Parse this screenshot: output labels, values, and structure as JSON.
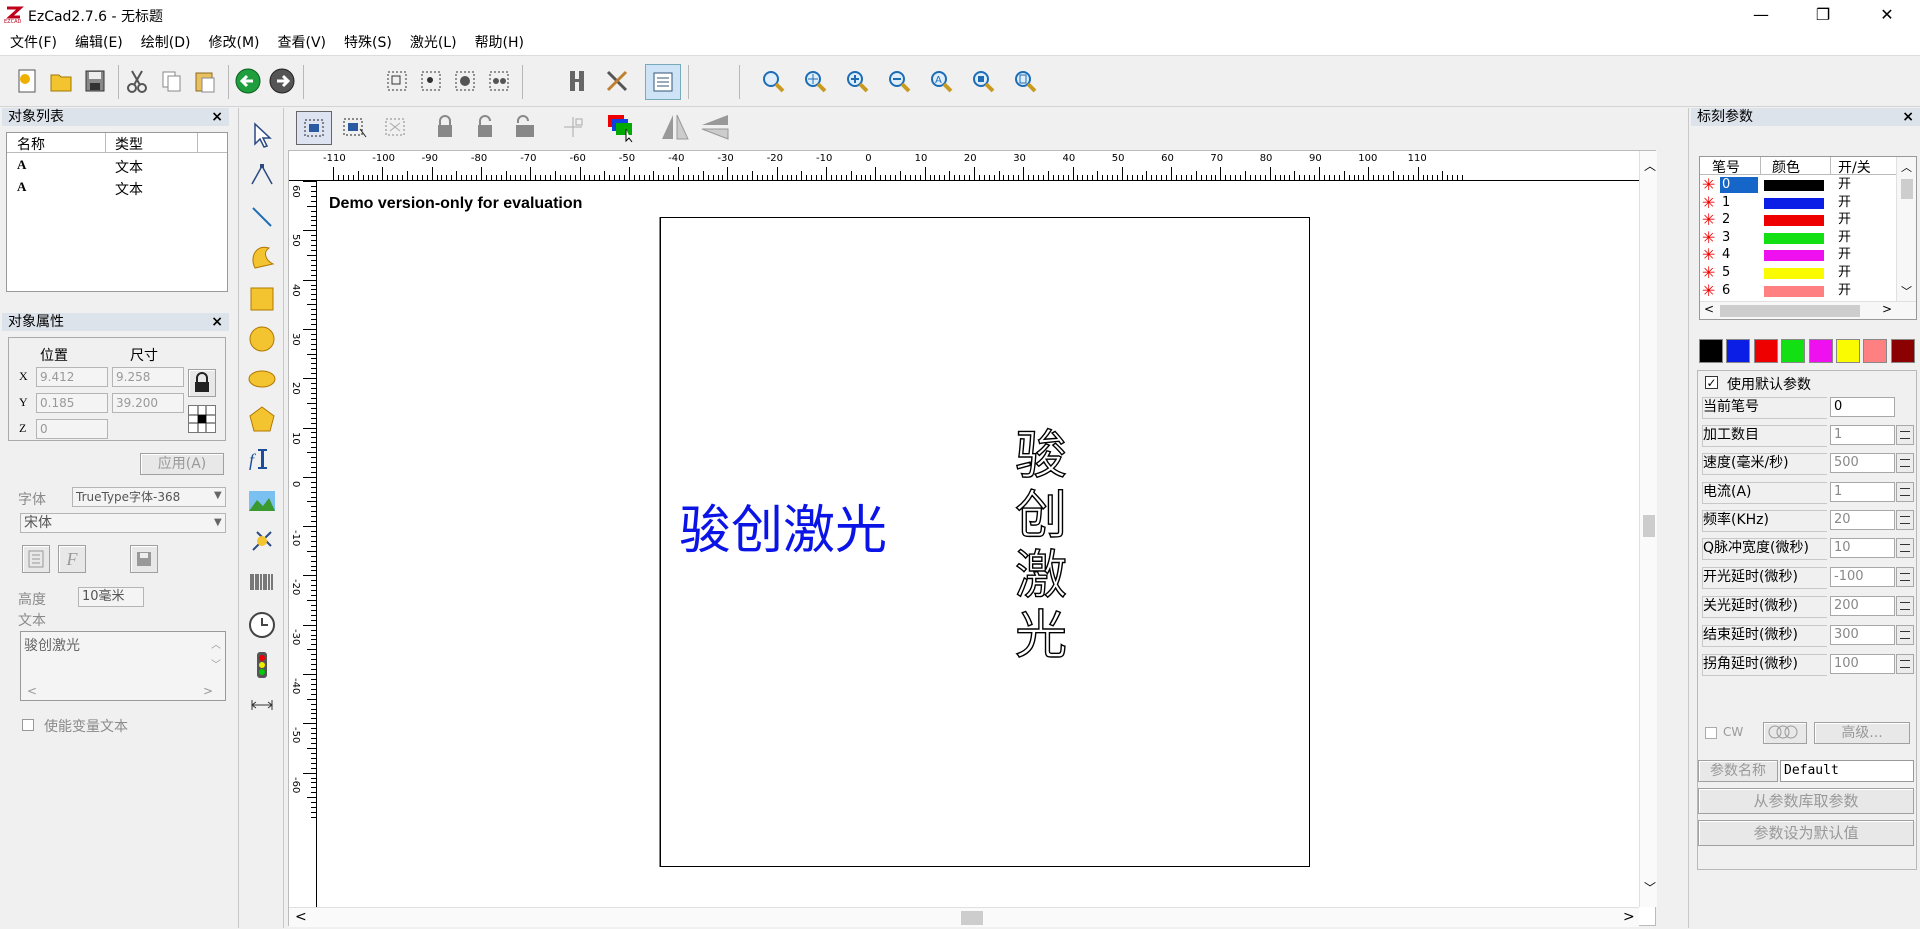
{
  "window": {
    "title": "EzCad2.7.6 - 无标题",
    "minimize": "—",
    "maximize": "❐",
    "close": "✕"
  },
  "menu": [
    "文件(F)",
    "编辑(E)",
    "绘制(D)",
    "修改(M)",
    "查看(V)",
    "特殊(S)",
    "激光(L)",
    "帮助(H)"
  ],
  "object_list": {
    "title": "对象列表",
    "columns": [
      "名称",
      "类型"
    ],
    "rows": [
      {
        "name": "A",
        "type": "文本"
      },
      {
        "name": "A",
        "type": "文本"
      }
    ]
  },
  "object_props": {
    "title": "对象属性",
    "pos_label": "位置",
    "size_label": "尺寸",
    "x_label": "X",
    "y_label": "Y",
    "z_label": "Z",
    "x": "9.412",
    "y": "0.185",
    "z": "0",
    "w": "9.258",
    "h": "39.200",
    "apply": "应用(A)",
    "font_label": "字体",
    "font_type": "TrueType字体-368",
    "font_name": "宋体",
    "height_label": "高度",
    "height_value": "10毫米",
    "text_label": "文本",
    "text_value": "骏创激光",
    "enable_var_text": "使能变量文本"
  },
  "canvas": {
    "demo_notice": "Demo version-only for evaluation",
    "horizontal_text": "骏创激光",
    "vertical_text": [
      "骏",
      "创",
      "激",
      "光"
    ],
    "text_color": "#0a14e6",
    "ruler_h": [
      "-110",
      "-100",
      "-90",
      "-80",
      "-70",
      "-60",
      "-50",
      "-40",
      "-30",
      "-20",
      "-10",
      "0",
      "10",
      "20",
      "30",
      "40",
      "50",
      "60",
      "70",
      "80",
      "90",
      "100",
      "110"
    ],
    "ruler_v": [
      "60",
      "50",
      "40",
      "30",
      "20",
      "10",
      "0",
      "-10",
      "-20",
      "-30",
      "-40",
      "-50",
      "-60"
    ]
  },
  "mark_params": {
    "title": "标刻参数",
    "pen_columns": [
      "笔号",
      "颜色",
      "开/关"
    ],
    "pens": [
      {
        "no": "0",
        "color": "#000000",
        "state": "开"
      },
      {
        "no": "1",
        "color": "#0a1ee6",
        "state": "开"
      },
      {
        "no": "2",
        "color": "#ee0000",
        "state": "开"
      },
      {
        "no": "3",
        "color": "#12e012",
        "state": "开"
      },
      {
        "no": "4",
        "color": "#ee10ee",
        "state": "开"
      },
      {
        "no": "5",
        "color": "#fafa00",
        "state": "开"
      },
      {
        "no": "6",
        "color": "#ff8080",
        "state": "开"
      }
    ],
    "palette": [
      "#000000",
      "#0a1ee6",
      "#ee0000",
      "#12e012",
      "#ee10ee",
      "#fafa00",
      "#ff8080",
      "#8b0000"
    ],
    "use_default": "使用默认参数",
    "params": [
      {
        "label": "当前笔号",
        "value": "0"
      },
      {
        "label": "加工数目",
        "value": "1"
      },
      {
        "label": "速度(毫米/秒)",
        "value": "500"
      },
      {
        "label": "电流(A)",
        "value": "1"
      },
      {
        "label": "频率(KHz)",
        "value": "20"
      },
      {
        "label": "Q脉冲宽度(微秒)",
        "value": "10"
      },
      {
        "label": "开光延时(微秒)",
        "value": "-100"
      },
      {
        "label": "关光延时(微秒)",
        "value": "200"
      },
      {
        "label": "结束延时(微秒)",
        "value": "300"
      },
      {
        "label": "拐角延时(微秒)",
        "value": "100"
      }
    ],
    "cw": "CW",
    "advanced": "高级...",
    "param_name_label": "参数名称",
    "param_name_value": "Default",
    "load_from_lib": "从参数库取参数",
    "set_default": "参数设为默认值"
  }
}
